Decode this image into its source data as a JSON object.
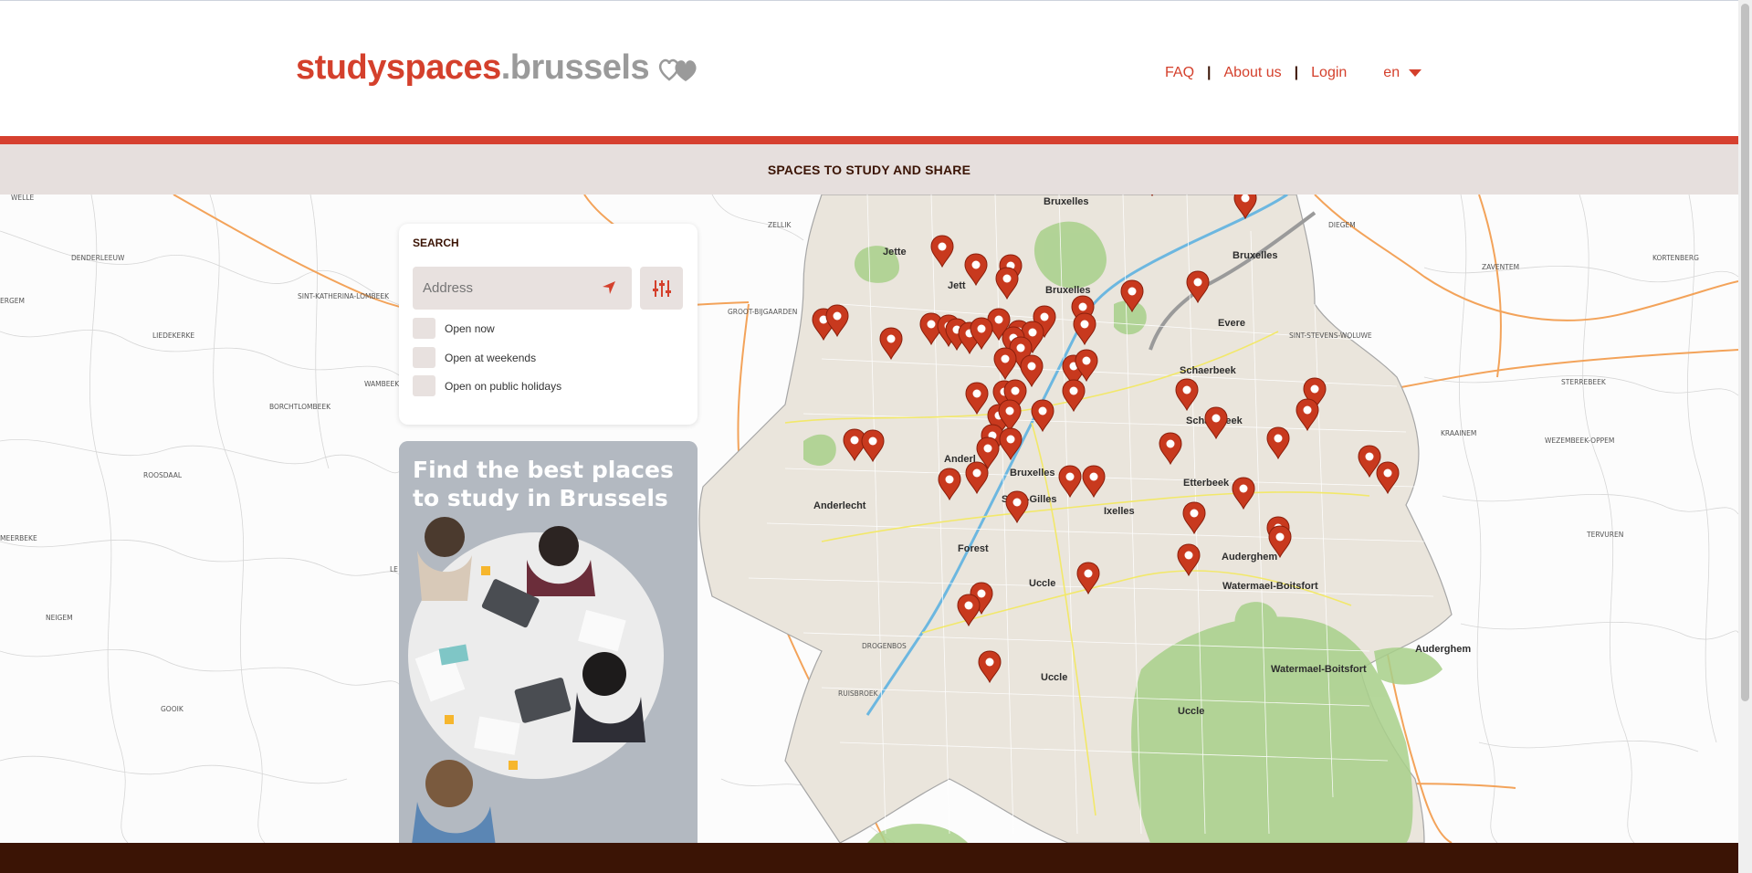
{
  "site": {
    "logo_main": "studyspaces",
    "logo_tld": ".brussels",
    "colors": {
      "accent": "#d4402c",
      "dark": "#3b1405",
      "subbar": "#e6dfdd",
      "field": "#e8e1df"
    }
  },
  "nav": {
    "faq": "FAQ",
    "about": "About us",
    "login": "Login",
    "language": "en"
  },
  "tagline": "SPACES TO STUDY AND SHARE",
  "search": {
    "title": "SEARCH",
    "address_placeholder": "Address",
    "locate_icon": "locate-arrow-icon",
    "filter_icon": "filter-sliders-icon",
    "options": [
      "Open now",
      "Open at weekends",
      "Open on public holidays"
    ]
  },
  "promo": {
    "title": "Find the best places to study in Brussels"
  },
  "map": {
    "region_labels": [
      "WELLE",
      "DENDERLEEUW",
      "ERGEM",
      "SINT-KATHERINA-LOMBEEK",
      "LIEDEKERKE",
      "WAMBEEK",
      "BORCHTLOMBEEK",
      "ROOSDAAL",
      "MEERBEKE",
      "NEIGEM",
      "GOOIK",
      "ZELLIK",
      "GROOT-BIJGAARDEN",
      "DIEGEM",
      "ZAVENTEM",
      "KORTENBERG",
      "SINT-STEVENS-WOLUWE",
      "STERREBEEK",
      "KRAAINEM",
      "WEZEMBEEK-OPPEM",
      "TERVUREN",
      "DROGENBOS",
      "RUISBROEK",
      "LE"
    ],
    "city_labels": [
      "Bruxelles",
      "Jette",
      "Jett",
      "Bruxelles",
      "Bruxelles",
      "Evere",
      "Schaerbeek",
      "Schaerbeek",
      "Anderl",
      "Bruxelles",
      "Anderlecht",
      "Saint-Gilles",
      "Ixelles",
      "Etterbeek",
      "Auderghem",
      "Forest",
      "Uccle",
      "Watermael-Boitsfort",
      "Uccle",
      "Watermael-Boitsfort",
      "Auderghem",
      "Uccle"
    ],
    "marker_icon": "map-pin-icon"
  }
}
